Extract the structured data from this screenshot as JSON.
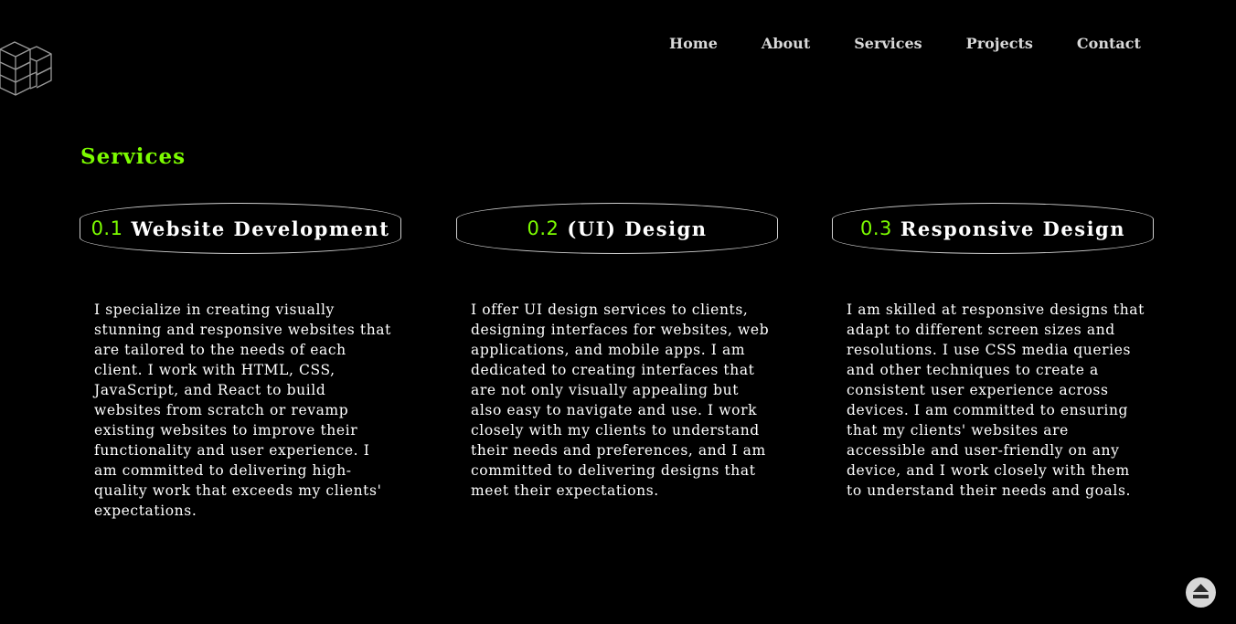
{
  "logo": {
    "icon": "stacked-cubes-logo-icon"
  },
  "nav": {
    "items": [
      {
        "label": "Home"
      },
      {
        "label": "About"
      },
      {
        "label": "Services"
      },
      {
        "label": "Projects"
      },
      {
        "label": "Contact"
      }
    ]
  },
  "services": {
    "title": "Services",
    "cards": [
      {
        "number": "0.1",
        "title": "Website Development",
        "description": "I specialize in creating visually stunning and responsive websites that are tailored to the needs of each client. I work with HTML, CSS, JavaScript, and React to build websites from scratch or revamp existing websites to improve their functionality and user experience. I am committed to delivering high-quality work that exceeds my clients' expectations."
      },
      {
        "number": "0.2",
        "title": "(UI) Design",
        "description": "I offer UI design services to clients, designing interfaces for websites, web applications, and mobile apps. I am dedicated to creating interfaces that are not only visually appealing but also easy to navigate and use. I work closely with my clients to understand their needs and preferences, and I am committed to delivering designs that meet their expectations."
      },
      {
        "number": "0.3",
        "title": "Responsive Design",
        "description": "I am skilled at responsive designs that adapt to different screen sizes and resolutions. I use CSS media queries and other techniques to create a consistent user experience across devices. I am committed to ensuring that my clients' websites are accessible and user-friendly on any device, and I work closely with them to understand their needs and goals."
      }
    ]
  },
  "scroll_top": {
    "icon": "eject-up-arrow-icon"
  },
  "colors": {
    "background": "#000000",
    "accent": "#7cfc00",
    "text": "#ffffff",
    "nav_text": "#d9d9d9",
    "border": "#cfcfcf"
  }
}
